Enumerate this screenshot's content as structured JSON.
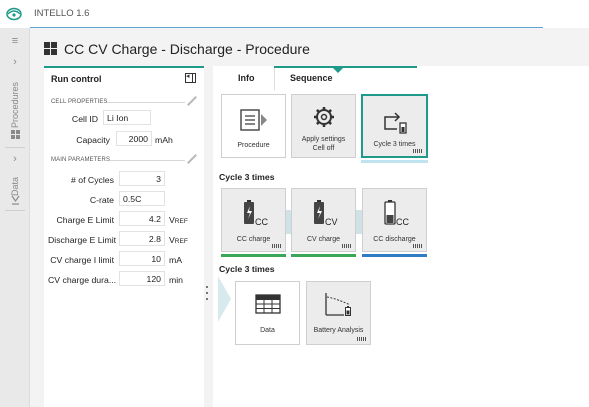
{
  "app": {
    "title": "INTELLO 1.6",
    "accent": "#1d9a8a"
  },
  "rail": {
    "menu_icon": "hamburger-icon",
    "expand_icon": "chevron-right-icon",
    "items": [
      {
        "label": "Procedures",
        "icon": "procedures-icon"
      },
      {
        "label": "Data",
        "icon": "data-icon"
      }
    ]
  },
  "header": {
    "icon": "grid-icon",
    "title": "CC CV Charge - Discharge - Procedure"
  },
  "run_control": {
    "title": "Run control",
    "collapse_icon": "collapse-panel-icon",
    "cell_properties": {
      "heading": "CELL PROPERTIES",
      "fields": [
        {
          "label": "Cell ID",
          "value": "Li Ion",
          "unit": ""
        },
        {
          "label": "Capacity",
          "value": "2000",
          "unit": "mAh"
        }
      ]
    },
    "main_parameters": {
      "heading": "MAIN PARAMETERS",
      "fields": [
        {
          "label": "# of Cycles",
          "value": "3",
          "unit": ""
        },
        {
          "label": "C-rate",
          "value": "0.5C",
          "unit": ""
        },
        {
          "label": "Charge E Limit",
          "value": "4.2",
          "unit": "VREF"
        },
        {
          "label": "Discharge E Limit",
          "value": "2.8",
          "unit": "VREF"
        },
        {
          "label": "CV charge I limit",
          "value": "10",
          "unit": "mA"
        },
        {
          "label": "CV charge dura...",
          "value": "120",
          "unit": "min"
        }
      ]
    }
  },
  "tabs": [
    {
      "label": "Info",
      "active": false
    },
    {
      "label": "Sequence",
      "active": true
    }
  ],
  "sequence": {
    "top_tiles": [
      {
        "label": "Procedure",
        "icon": "procedure-icon"
      },
      {
        "label": "Apply settings\nCell off",
        "icon": "gear-icon"
      },
      {
        "label": "Cycle 3 times",
        "icon": "cycle-icon"
      }
    ],
    "group1": {
      "title": "Cycle 3 times",
      "tiles": [
        {
          "label": "CC charge",
          "icon": "battery-charge-icon",
          "badge": "CC",
          "status_color": "#3aa657"
        },
        {
          "label": "CV charge",
          "icon": "battery-charge-icon",
          "badge": "CV",
          "status_color": "#3aa657"
        },
        {
          "label": "CC discharge",
          "icon": "battery-discharge-icon",
          "badge": "CC",
          "status_color": "#2f7cc4"
        }
      ]
    },
    "group2": {
      "title": "Cycle 3 times",
      "tiles": [
        {
          "label": "Data",
          "icon": "table-icon"
        },
        {
          "label": "Battery Analysis",
          "icon": "battery-analysis-icon"
        }
      ]
    }
  }
}
